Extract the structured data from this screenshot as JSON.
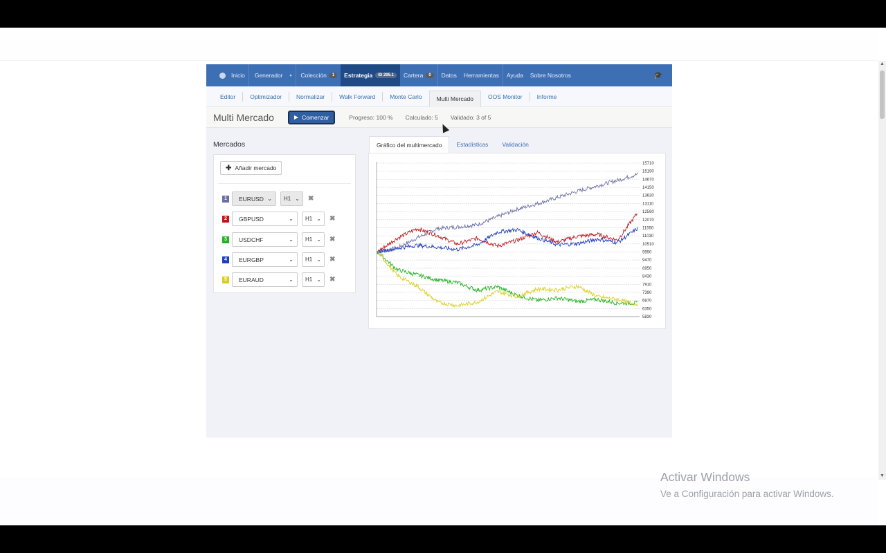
{
  "topnav": {
    "items": [
      {
        "label": "Inicio"
      },
      {
        "label": "Generador",
        "caret": "▾"
      },
      {
        "label": "Colección",
        "badge": "1"
      },
      {
        "label": "Estrategia",
        "badge": "ID 295.1"
      },
      {
        "label": "Cartera",
        "badge": "0"
      },
      {
        "label": "Datos"
      },
      {
        "label": "Herramientas"
      },
      {
        "label": "Ayuda"
      },
      {
        "label": "Sobre Nosotros"
      }
    ]
  },
  "subnav": {
    "items": [
      "Editor",
      "Optimizador",
      "Normalizar",
      "Walk Forward",
      "Monte Carlo",
      "Multi Mercado",
      "OOS Monitor",
      "Informe"
    ],
    "active": "Multi Mercado"
  },
  "toolbar": {
    "title": "Multi Mercado",
    "start_label": "Comenzar",
    "progress": "Progreso: 100 %",
    "calculated": "Calculado: 5",
    "validated": "Validado: 3 of 5"
  },
  "markets": {
    "title": "Mercados",
    "add_label": "Añadir mercado",
    "rows": [
      {
        "num": "1",
        "symbol": "EURUSD",
        "tf": "H1",
        "color": "#6b6fa6"
      },
      {
        "num": "2",
        "symbol": "GBPUSD",
        "tf": "H1",
        "color": "#c0161b"
      },
      {
        "num": "3",
        "symbol": "USDCHF",
        "tf": "H1",
        "color": "#22b222"
      },
      {
        "num": "4",
        "symbol": "EURGBP",
        "tf": "H1",
        "color": "#1f3fbf"
      },
      {
        "num": "5",
        "symbol": "EURAUD",
        "tf": "H1",
        "color": "#d8d01a"
      }
    ]
  },
  "chart_tabs": [
    "Gráfico del multimercado",
    "Estadísticas",
    "Validación"
  ],
  "chart_data": {
    "type": "line",
    "yticks": [
      15710,
      15190,
      14670,
      14150,
      13630,
      13110,
      12590,
      12070,
      11550,
      11030,
      10510,
      9990,
      9470,
      8950,
      8430,
      7910,
      7390,
      6870,
      6350,
      5830
    ],
    "ylim": [
      5830,
      15710
    ],
    "grid": true,
    "series": [
      {
        "color": "#6b6fa6",
        "start": 10000,
        "end": 15000
      },
      {
        "color": "#c0161b",
        "start": 10000,
        "end": 12500
      },
      {
        "color": "#22b222",
        "start": 10000,
        "end": 6700
      },
      {
        "color": "#1f3fbf",
        "start": 10000,
        "end": 11500
      },
      {
        "color": "#d8d01a",
        "start": 10000,
        "end": 6600
      }
    ]
  },
  "watermark": {
    "title": "Activar Windows",
    "subtitle": "Ve a Configuración para activar Windows."
  }
}
